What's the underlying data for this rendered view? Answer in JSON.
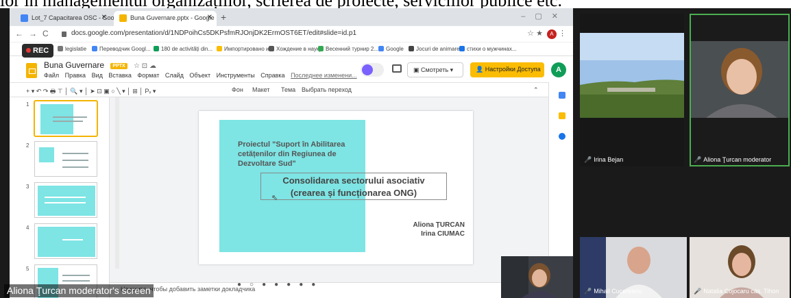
{
  "caption_text": "lor în managementul organizațiilor, scrierea de proiecte, serviciilor publice etc.",
  "browser": {
    "tabs": [
      {
        "label": "Lot_7 Capacitarea OSC - Googl",
        "active": false
      },
      {
        "label": "Buna Guvernare.pptx - Google",
        "active": true
      }
    ],
    "url": "docs.google.com/presentation/d/1NDPoihCs5DKPsfmRJOnjDK2ErmOST6ET/edit#slide=id.p1",
    "bookmarks": [
      "legislatie",
      "Переводчик Googl...",
      "180 de activități din...",
      "Импортировано и...",
      "Хождение в науку",
      "Весенний турнир 2...",
      "Google",
      "Jocuri de animare",
      "стихи о мужчинах..."
    ],
    "account_initial": "A"
  },
  "recording": {
    "label": "REC"
  },
  "slides_app": {
    "title": "Buna Guvernare",
    "format_badge": "PPTX",
    "menus": [
      "Файл",
      "Правка",
      "Вид",
      "Вставка",
      "Формат",
      "Слайд",
      "Объект",
      "Инструменты",
      "Справка"
    ],
    "last_edit": "Последнее изменени...",
    "present_label": "Смотреть",
    "share_label": "Настройки Доступа",
    "account_initial": "A",
    "toolbar": {
      "background": "Фон",
      "layout": "Макет",
      "theme": "Тема",
      "transition": "Выбрать переход"
    },
    "slide_numbers": [
      "1",
      "2",
      "3",
      "4",
      "5"
    ],
    "notes_placeholder": "Нажмите, чтобы добавить заметки докладчика",
    "accent": "#f4b400",
    "slide_accent": "#7ee4e4"
  },
  "slide": {
    "project": "Proiectul \"Suport în Abilitarea\ncetățenilor din Regiunea de\nDezvoltare Sud\"",
    "heading": "Consolidarea sectorului asociativ\n(crearea și funcționarea ONG)",
    "authors": "Aliona ȚURCAN\nIrina CIUMAC"
  },
  "share_screen_label": "Aliona Ţurcan moderator's screen",
  "participants": [
    {
      "name": "Irina Bejan",
      "speaking": false
    },
    {
      "name": "Aliona Ţurcan moderator",
      "speaking": true
    },
    {
      "name": "Mihail Cucereanu",
      "speaking": false
    },
    {
      "name": "Natalia Cojocaru cás. Tihon",
      "speaking": false
    }
  ]
}
